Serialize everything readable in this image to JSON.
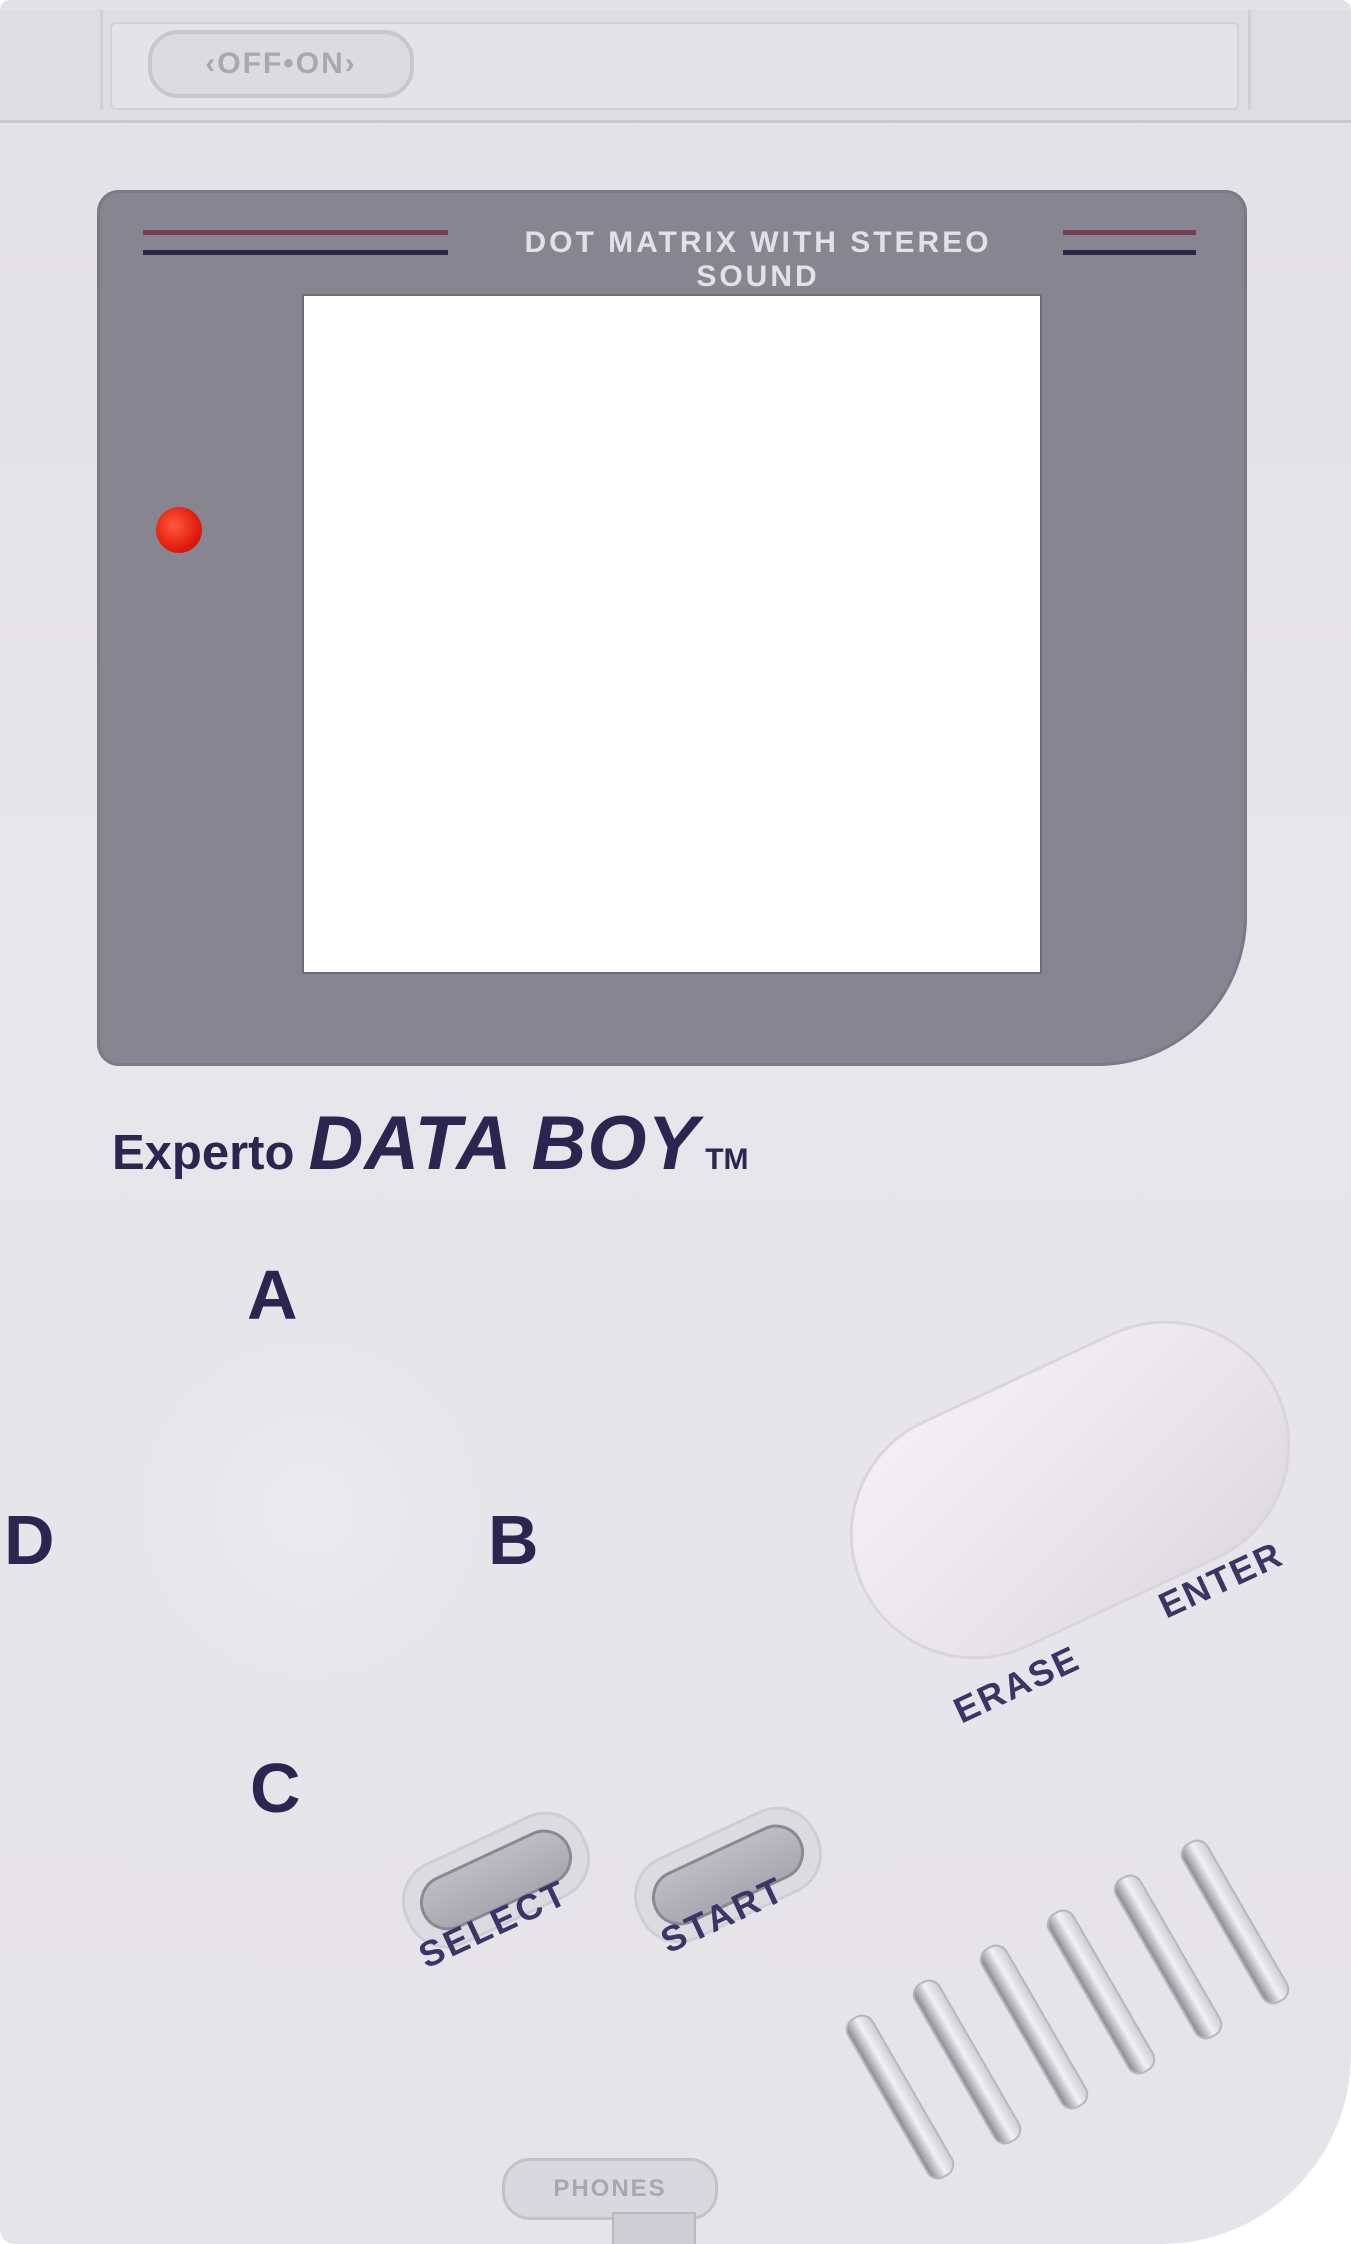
{
  "device": {
    "power_switch_label": "‹OFF•ON›",
    "screen_label": "DOT MATRIX WITH STEREO SOUND",
    "brand_prefix": "Experto",
    "brand_name": "DATA BOY",
    "brand_tm": "TM",
    "bottom_jack_label": "PHONES"
  },
  "controls": {
    "direction_up": "A",
    "direction_left": "D",
    "direction_right": "B",
    "direction_down": "C",
    "erase_label": "ERASE",
    "enter_label": "ENTER",
    "select_label": "SELECT",
    "start_label": "START"
  },
  "colors": {
    "body": "#e4e3e8",
    "bezel": "#878590",
    "label_ink": "#2c2550",
    "led": "#e21c10",
    "stripe_maroon": "#7a3e52",
    "stripe_navy": "#2a2846"
  },
  "icons": {
    "power_led": "power-led-icon",
    "speaker": "speaker-grille-icon"
  }
}
